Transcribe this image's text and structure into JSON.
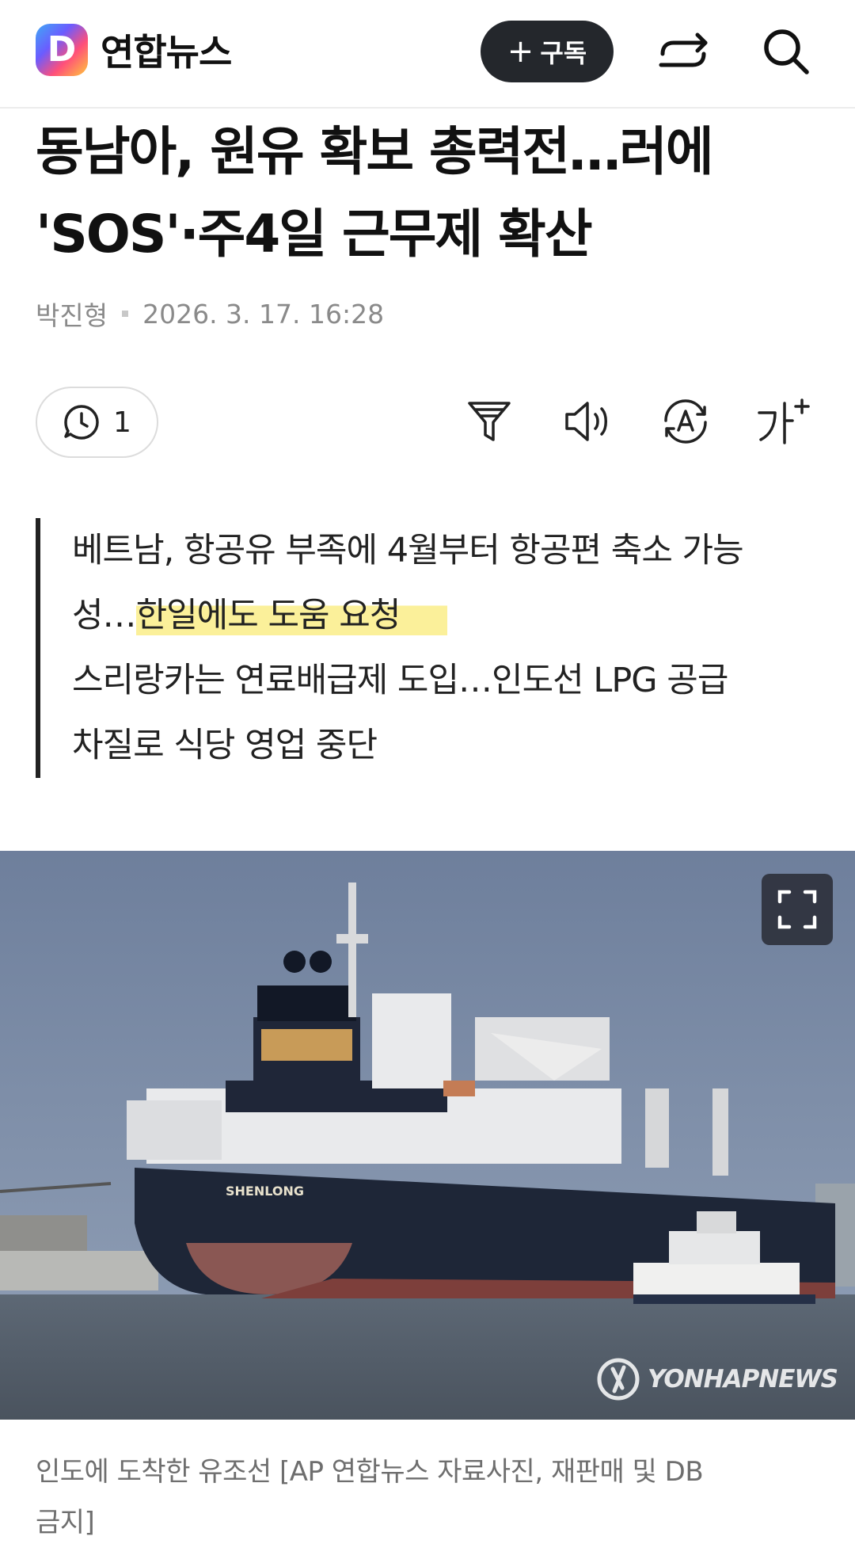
{
  "header": {
    "logo_letter": "D",
    "logo_text": "연합뉴스",
    "subscribe_label": "구독",
    "subscribe_plus": "+",
    "share_icon": "share-icon",
    "search_icon": "search-icon"
  },
  "article": {
    "title_line1": "동남아, 원유 확보 총력전…러에",
    "title_line2": "'SOS'·주4일 근무제 확산",
    "author": "박진형",
    "datetime": "2026. 3. 17. 16:28"
  },
  "toolbar": {
    "comment_count": "1",
    "icons": [
      "comment-icon",
      "filter-icon",
      "speaker-icon",
      "translate-icon",
      "font-size-icon"
    ],
    "font_size_label": "가"
  },
  "summary": {
    "line1": "베트남, 항공유 부족에 4월부터 항공편 축소 가능",
    "line2_plain": "성…",
    "line2_highlight": "한일에도 도움 요청",
    "line3": "스리랑카는 연료배급제 도입…인도선 LPG 공급",
    "line4": "차질로 식당 영업 중단"
  },
  "photo": {
    "ship_name": "SHENLONG",
    "watermark": "YONHAPNEWS",
    "caption_line1": "인도에 도착한 유조선 [AP 연합뉴스 자료사진, 재판매 및 DB",
    "caption_line2": "금지]"
  },
  "colors": {
    "highlight": "#fbf09a",
    "subscribe_bg": "#24272c",
    "meta_text": "#8a8a8a"
  }
}
